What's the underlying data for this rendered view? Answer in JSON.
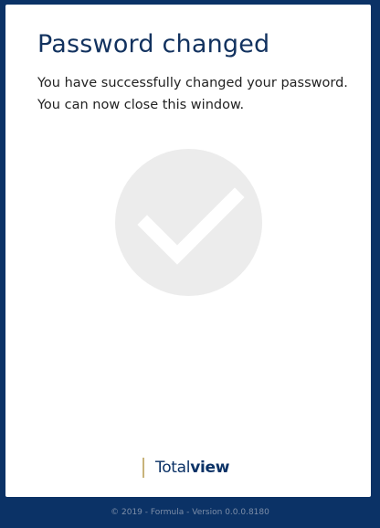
{
  "card": {
    "title": "Password changed",
    "message_line1": "You have successfully changed your password.",
    "message_line2": "You can now close this window.",
    "status_icon": "checkmark-icon"
  },
  "brand": {
    "name_light": "Total",
    "name_bold": "view"
  },
  "footer": {
    "text": "© 2019 - Formula - Version 0.0.0.8180"
  },
  "colors": {
    "background": "#0b3266",
    "card": "#ffffff",
    "title": "#12325f",
    "check_circle": "#ececec",
    "check_mark": "#ffffff",
    "brand_bar": "#c8b37a"
  }
}
